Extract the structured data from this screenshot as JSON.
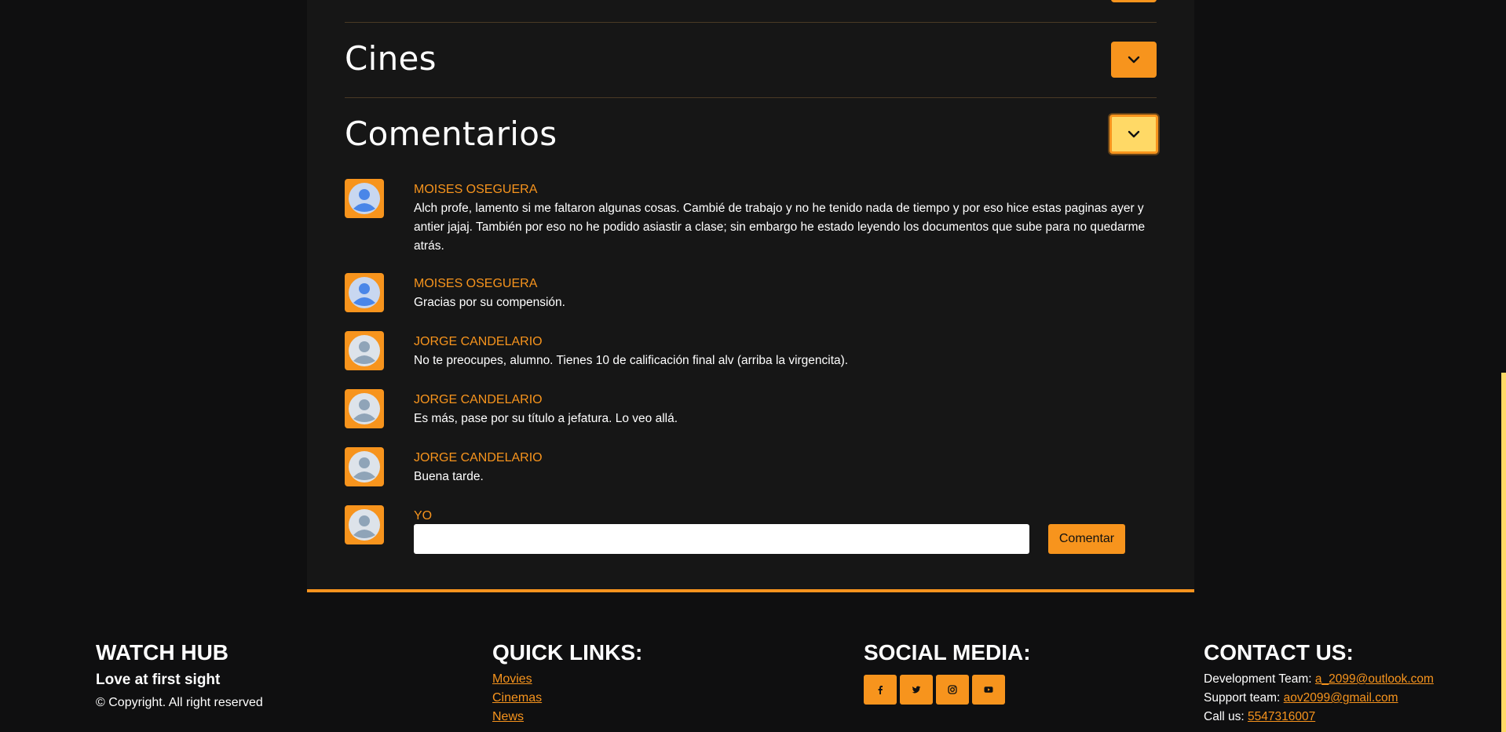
{
  "sections": [
    {
      "title": "Cines"
    },
    {
      "title": "Comentarios"
    }
  ],
  "comments": [
    {
      "author": "MOISES OSEGUERA",
      "text": "Alch profe, lamento si me faltaron algunas cosas. Cambié de trabajo y no he tenido nada de tiempo y por eso hice estas paginas ayer y antier jajaj. También por eso no he podido asiastir a clase; sin embargo he estado leyendo los documentos que sube para no quedarme atrás.",
      "avatar": "user-avatar-blue"
    },
    {
      "author": "MOISES OSEGUERA",
      "text": "Gracias por su compensión.",
      "avatar": "user-avatar-blue"
    },
    {
      "author": "JORGE CANDELARIO",
      "text": "No te preocupes, alumno. Tienes 10 de calificación final alv (arriba la virgencita).",
      "avatar": "user-avatar-gray"
    },
    {
      "author": "JORGE CANDELARIO",
      "text": "Es más, pase por su título a jefatura. Lo veo allá.",
      "avatar": "user-avatar-gray"
    },
    {
      "author": "JORGE CANDELARIO",
      "text": "Buena tarde.",
      "avatar": "user-avatar-gray"
    }
  ],
  "new_comment": {
    "author": "YO",
    "input_value": "",
    "button_label": "Comentar"
  },
  "footer": {
    "brand": {
      "title": "WATCH HUB",
      "tagline": "Love at first sight",
      "copyright": "© Copyright. All right reserved"
    },
    "quick_links": {
      "heading": "QUICK LINKS:",
      "links": [
        "Movies",
        "Cinemas",
        "News"
      ]
    },
    "social": {
      "heading": "SOCIAL MEDIA:",
      "icons": [
        "facebook-icon",
        "twitter-icon",
        "instagram-icon",
        "youtube-icon"
      ]
    },
    "contact": {
      "heading": "CONTACT US:",
      "dev_label": "Development Team:",
      "dev_email": "a_2099@outlook.com",
      "support_label": "Support team:",
      "support_email": "aov2099@gmail.com",
      "call_label": "Call us:",
      "phone": "5547316007"
    }
  },
  "colors": {
    "accent": "#f7941d",
    "accent_light": "#ffd966",
    "background": "#0f0f10",
    "panel": "#161616"
  }
}
